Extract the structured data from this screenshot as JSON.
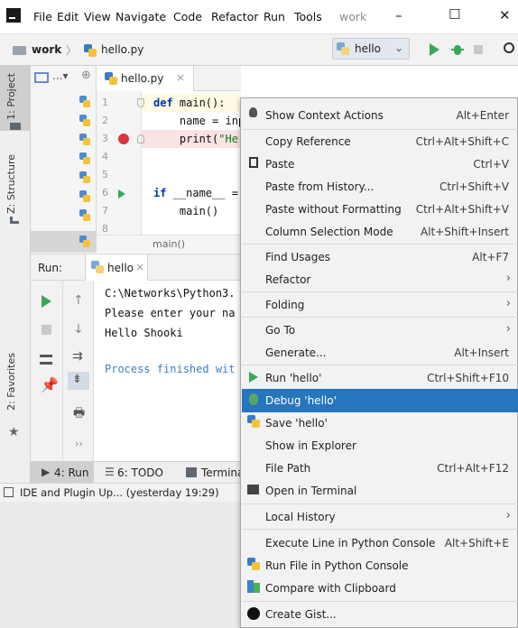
{
  "titlebar": {
    "menu": [
      "File",
      "Edit",
      "View",
      "Navigate",
      "Code",
      "Refactor",
      "Run",
      "Tools",
      "work"
    ],
    "controls": [
      "–",
      "☐",
      "✕"
    ]
  },
  "navbar": {
    "project": "work",
    "separator": "〉",
    "file": "hello.py",
    "run_config": "hello"
  },
  "side_tabs": {
    "project": "1: Project",
    "structure": "Z: Structure",
    "favorites": "2: Favorites"
  },
  "editor": {
    "tab": "hello.py",
    "line_numbers": [
      "1",
      "2",
      "3",
      "4",
      "5",
      "6",
      "7",
      "8"
    ],
    "lines": {
      "l1_kw": "def",
      "l1_rest": " main():",
      "l2": "    name = inp",
      "l3_a": "    print(",
      "l3_b": "\"He",
      "l6_kw": "if",
      "l6_rest": " __name__ =",
      "l7": "    main()"
    },
    "breadcrumb": "main()"
  },
  "run_panel": {
    "label": "Run:",
    "tab": "hello",
    "console": [
      "C:\\Networks\\Python3.",
      "Please enter your na",
      "Hello Shooki",
      "",
      "Process finished wit"
    ]
  },
  "bottom_tabs": {
    "run": "4: Run",
    "todo": "6: TODO",
    "terminal": "Termina"
  },
  "status": {
    "text": "IDE and Plugin Up... (yesterday 19:29)"
  },
  "context_menu": {
    "items": [
      {
        "label": "Show Context Actions",
        "shortcut": "Alt+Enter"
      },
      {
        "label": "Copy Reference",
        "shortcut": "Ctrl+Alt+Shift+C"
      },
      {
        "label": "Paste",
        "shortcut": "Ctrl+V"
      },
      {
        "label": "Paste from History...",
        "shortcut": "Ctrl+Shift+V"
      },
      {
        "label": "Paste without Formatting",
        "shortcut": "Ctrl+Alt+Shift+V"
      },
      {
        "label": "Column Selection Mode",
        "shortcut": "Alt+Shift+Insert"
      },
      {
        "label": "Find Usages",
        "shortcut": "Alt+F7"
      },
      {
        "label": "Refactor",
        "shortcut": ""
      },
      {
        "label": "Folding",
        "shortcut": ""
      },
      {
        "label": "Go To",
        "shortcut": ""
      },
      {
        "label": "Generate...",
        "shortcut": "Alt+Insert"
      },
      {
        "label": "Run 'hello'",
        "shortcut": "Ctrl+Shift+F10"
      },
      {
        "label": "Debug 'hello'",
        "shortcut": ""
      },
      {
        "label": "Save 'hello'",
        "shortcut": ""
      },
      {
        "label": "Show in Explorer",
        "shortcut": ""
      },
      {
        "label": "File Path",
        "shortcut": "Ctrl+Alt+F12"
      },
      {
        "label": "Open in Terminal",
        "shortcut": ""
      },
      {
        "label": "Local History",
        "shortcut": ""
      },
      {
        "label": "Execute Line in Python Console",
        "shortcut": "Alt+Shift+E"
      },
      {
        "label": "Run File in Python Console",
        "shortcut": ""
      },
      {
        "label": "Compare with Clipboard",
        "shortcut": ""
      },
      {
        "label": "Create Gist...",
        "shortcut": ""
      }
    ]
  },
  "colors": {
    "selection": "#2675bf",
    "run_green": "#3aa757",
    "breakpoint_red": "#d9363e",
    "keyword_blue": "#0033b3"
  },
  "icons": {
    "app": "pycharm-icon",
    "run": "run-icon",
    "debug": "bug-icon",
    "stop": "stop-icon",
    "search": "search-icon"
  }
}
